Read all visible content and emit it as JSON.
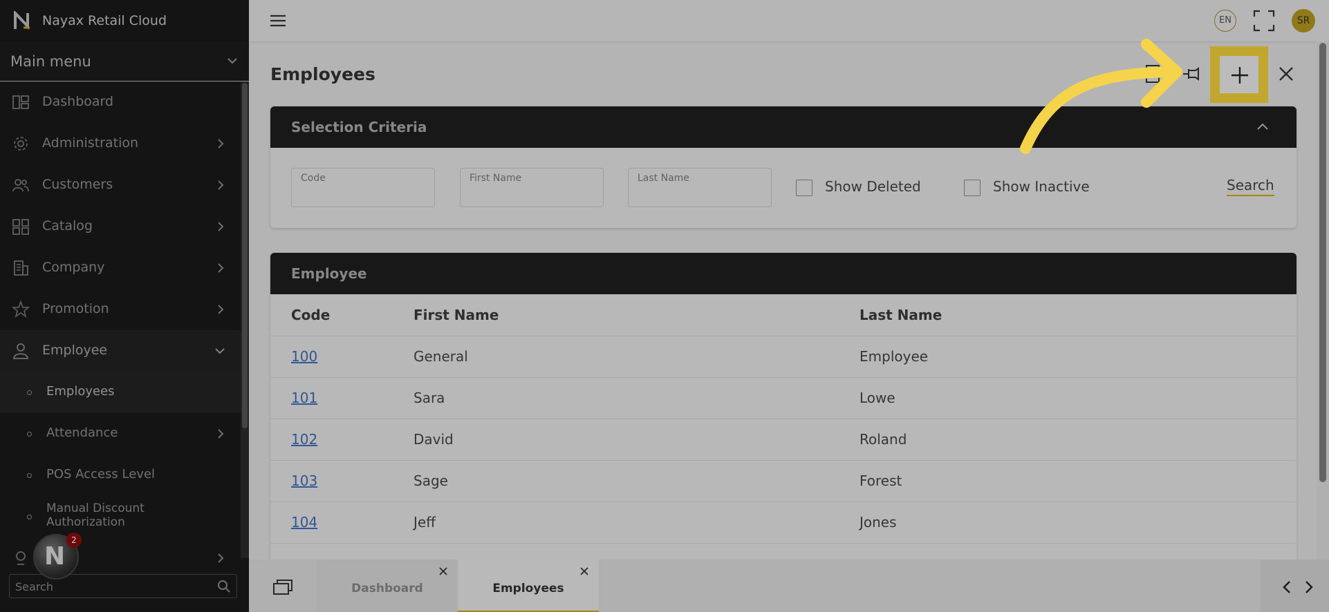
{
  "app": {
    "title": "Nayax Retail Cloud"
  },
  "sidebar": {
    "main_menu_label": "Main menu",
    "items": [
      {
        "label": "Dashboard",
        "icon": "dashboard-icon"
      },
      {
        "label": "Administration",
        "icon": "gear-icon"
      },
      {
        "label": "Customers",
        "icon": "users-icon"
      },
      {
        "label": "Catalog",
        "icon": "grid-icon"
      },
      {
        "label": "Company",
        "icon": "building-icon"
      },
      {
        "label": "Promotion",
        "icon": "star-icon"
      },
      {
        "label": "Employee",
        "icon": "employee-icon"
      }
    ],
    "sub_items": [
      {
        "label": "Employees"
      },
      {
        "label": "Attendance"
      },
      {
        "label": "POS Access Level"
      },
      {
        "label": "Manual Discount Authorization"
      }
    ],
    "search_placeholder": "Search",
    "notification_count": "2"
  },
  "topbar": {
    "language": "EN",
    "user_initials": "SR"
  },
  "page": {
    "title": "Employees",
    "selection": {
      "title": "Selection Criteria",
      "fields": [
        {
          "label": "Code",
          "value": ""
        },
        {
          "label": "First Name",
          "value": ""
        },
        {
          "label": "Last Name",
          "value": ""
        }
      ],
      "show_deleted": "Show Deleted",
      "show_inactive": "Show Inactive",
      "search": "Search"
    },
    "table": {
      "title": "Employee",
      "columns": [
        "Code",
        "First Name",
        "Last Name"
      ],
      "rows": [
        {
          "code": "100",
          "first": "General",
          "last": "Employee"
        },
        {
          "code": "101",
          "first": "Sara",
          "last": "Lowe"
        },
        {
          "code": "102",
          "first": "David",
          "last": "Roland"
        },
        {
          "code": "103",
          "first": "Sage",
          "last": "Forest"
        },
        {
          "code": "104",
          "first": "Jeff",
          "last": "Jones"
        }
      ]
    }
  },
  "tabs": [
    {
      "label": "Dashboard",
      "active": false
    },
    {
      "label": "Employees",
      "active": true
    }
  ],
  "colors": {
    "highlight": "#f2d13d",
    "accent": "#c8a914",
    "sidebar_bg": "#1a1a1a",
    "link": "#3f6bb8"
  }
}
